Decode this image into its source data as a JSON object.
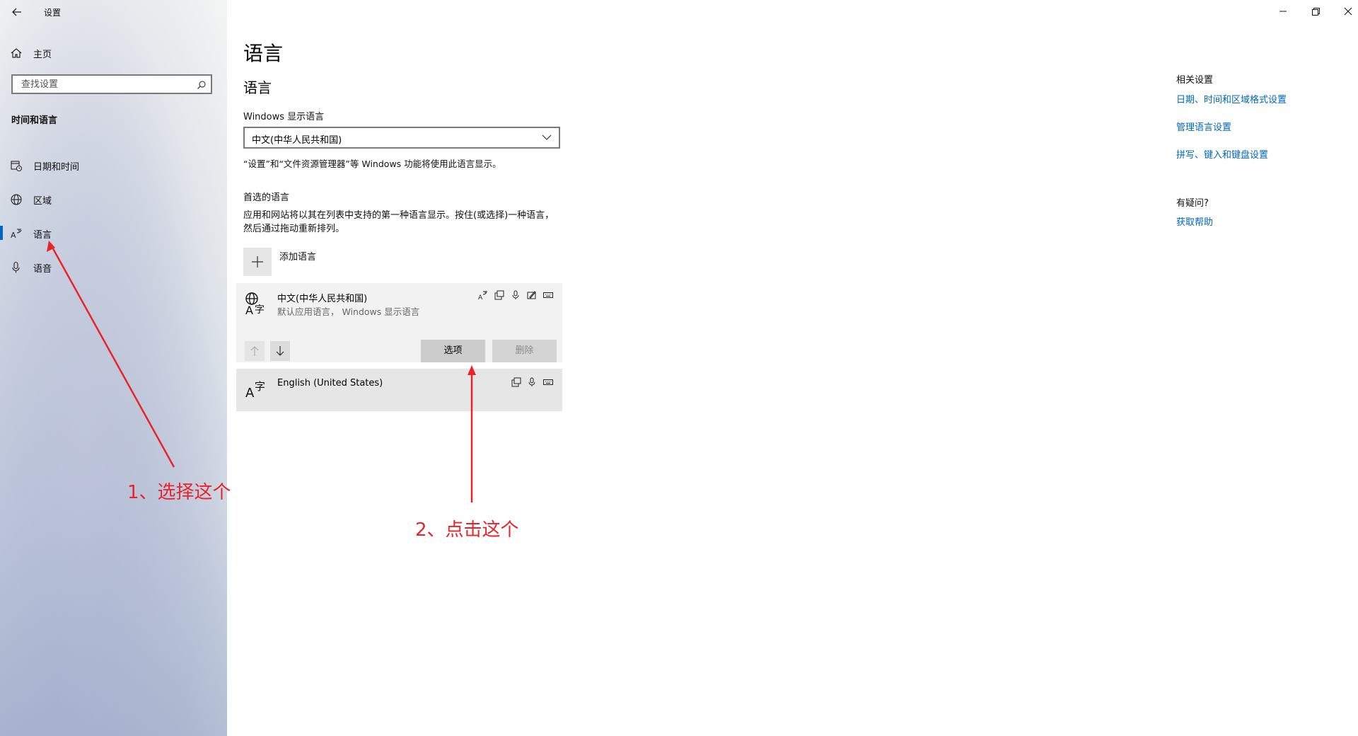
{
  "window": {
    "title": "设置",
    "controls": [
      "minimize-icon",
      "restore-icon",
      "close-icon"
    ]
  },
  "sidebar": {
    "home_label": "主页",
    "search_placeholder": "查找设置",
    "section_title": "时间和语言",
    "items": [
      {
        "label": "日期和时间",
        "icon": "calendar-clock-icon"
      },
      {
        "label": "区域",
        "icon": "globe-icon"
      },
      {
        "label": "语言",
        "icon": "language-icon",
        "selected": true
      },
      {
        "label": "语音",
        "icon": "microphone-icon"
      }
    ]
  },
  "main": {
    "page_title": "语言",
    "section_title": "语言",
    "display_language": {
      "label": "Windows 显示语言",
      "value": "中文(中华人民共和国)",
      "note": "“设置”和“文件资源管理器”等 Windows 功能将使用此语言显示。"
    },
    "preferred": {
      "title": "首选的语言",
      "description": "应用和网站将以其在列表中支持的第一种语言显示。按住(或选择)一种语言，然后通过拖动重新排列。",
      "add_label": "添加语言",
      "languages": [
        {
          "name": "中文(中华人民共和国)",
          "subtitle": "默认应用语言， Windows 显示语言",
          "feature_icons": [
            "display-language-icon",
            "text-to-speech-icon",
            "speech-icon",
            "handwriting-icon",
            "keyboard-icon"
          ],
          "options_label": "选项",
          "remove_label": "删除"
        },
        {
          "name": "English (United States)",
          "subtitle": "",
          "feature_icons": [
            "text-to-speech-icon",
            "speech-icon",
            "keyboard-icon"
          ]
        }
      ]
    }
  },
  "related": {
    "title": "相关设置",
    "links": [
      "日期、时间和区域格式设置",
      "管理语言设置",
      "拼写、键入和键盘设置"
    ],
    "question_title": "有疑问?",
    "help_link": "获取帮助"
  },
  "annotations": {
    "step1": "1、选择这个",
    "step2": "2、点击这个",
    "color": "#e8242b"
  },
  "colors": {
    "accent": "#0067c0",
    "annotation": "#e8242b"
  }
}
